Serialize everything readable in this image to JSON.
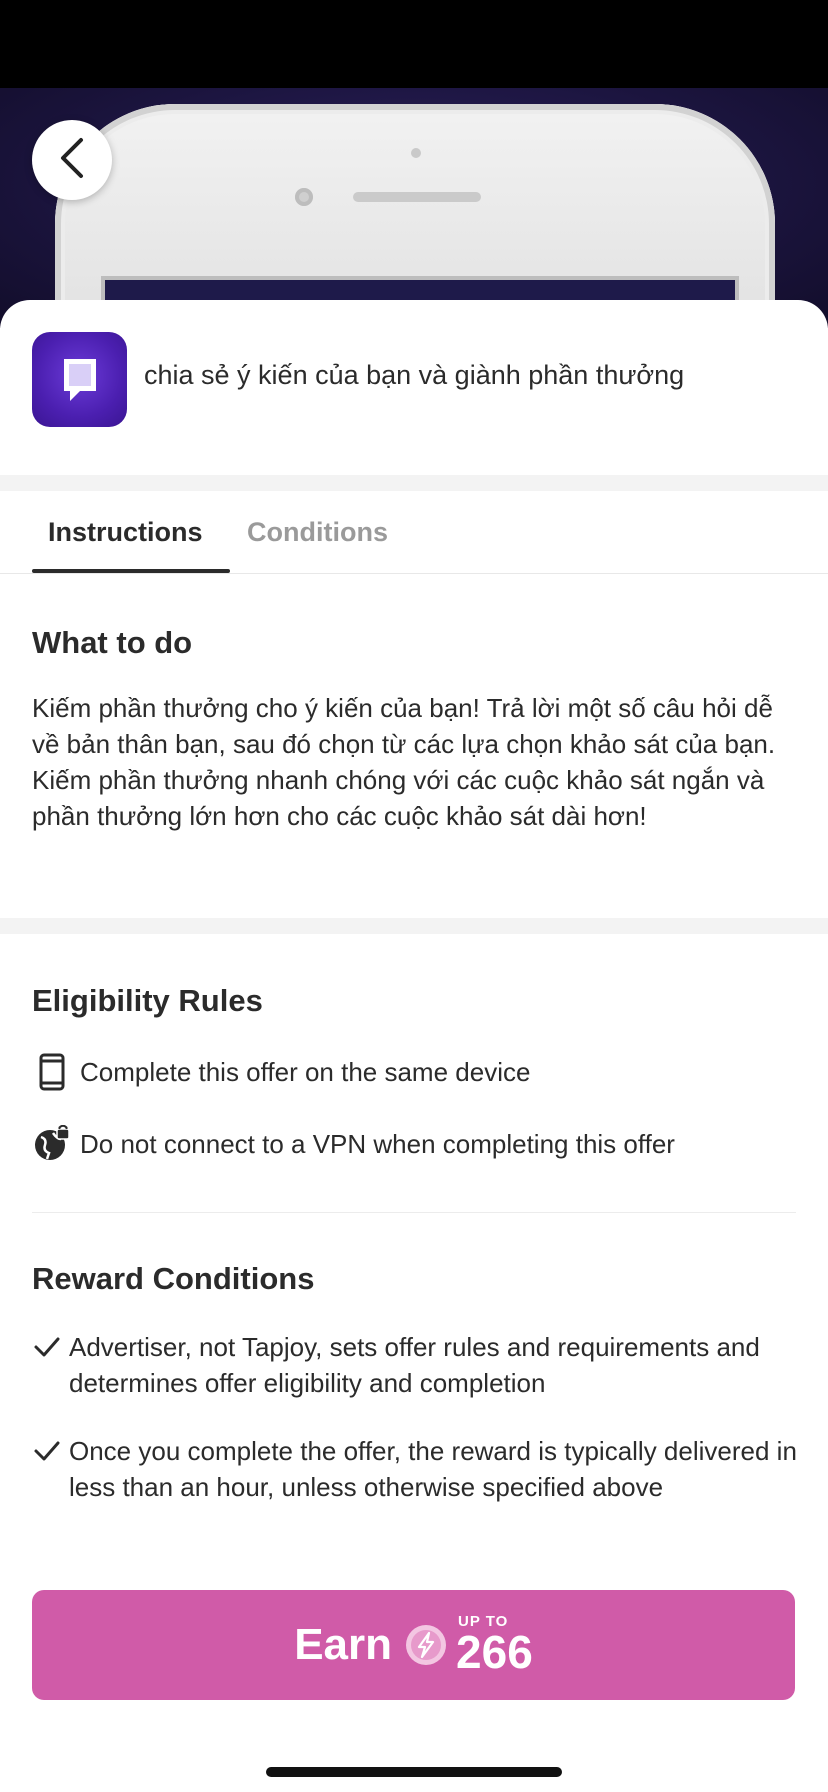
{
  "offer": {
    "title": "chia sẻ ý kiến của bạn và giành phần thưởng"
  },
  "tabs": [
    {
      "label": "Instructions",
      "active": true
    },
    {
      "label": "Conditions",
      "active": false
    }
  ],
  "what_to_do": {
    "title": "What to do",
    "body": "Kiếm phần thưởng cho ý kiến của bạn! Trả lời một số câu hỏi dễ về bản thân bạn, sau đó chọn từ các lựa chọn khảo sát của bạn. Kiếm phần thưởng nhanh chóng với các cuộc khảo sát ngắn và phần thưởng lớn hơn cho các cuộc khảo sát dài hơn!"
  },
  "eligibility": {
    "title": "Eligibility Rules",
    "rules": [
      {
        "icon": "phone-icon",
        "text": "Complete this offer on the same device"
      },
      {
        "icon": "globe-lock-icon",
        "text": "Do not connect to a VPN when completing this offer"
      }
    ]
  },
  "reward_conditions": {
    "title": "Reward Conditions",
    "items": [
      {
        "icon": "check-icon",
        "text": "Advertiser, not Tapjoy, sets offer rules and requirements and determines offer eligibility and completion"
      },
      {
        "icon": "check-icon",
        "text": "Once you complete the offer, the reward is typically delivered in less than an hour, unless otherwise specified above"
      }
    ]
  },
  "earn_button": {
    "label": "Earn",
    "prefix": "UP TO",
    "amount": "266",
    "color": "#d05ba8"
  },
  "colors": {
    "accent": "#d05ba8",
    "app_icon": "#4b1fb0",
    "hero_bg": "#1c1540",
    "text": "#2b2b2b",
    "muted_tab": "#9a9a9a"
  }
}
